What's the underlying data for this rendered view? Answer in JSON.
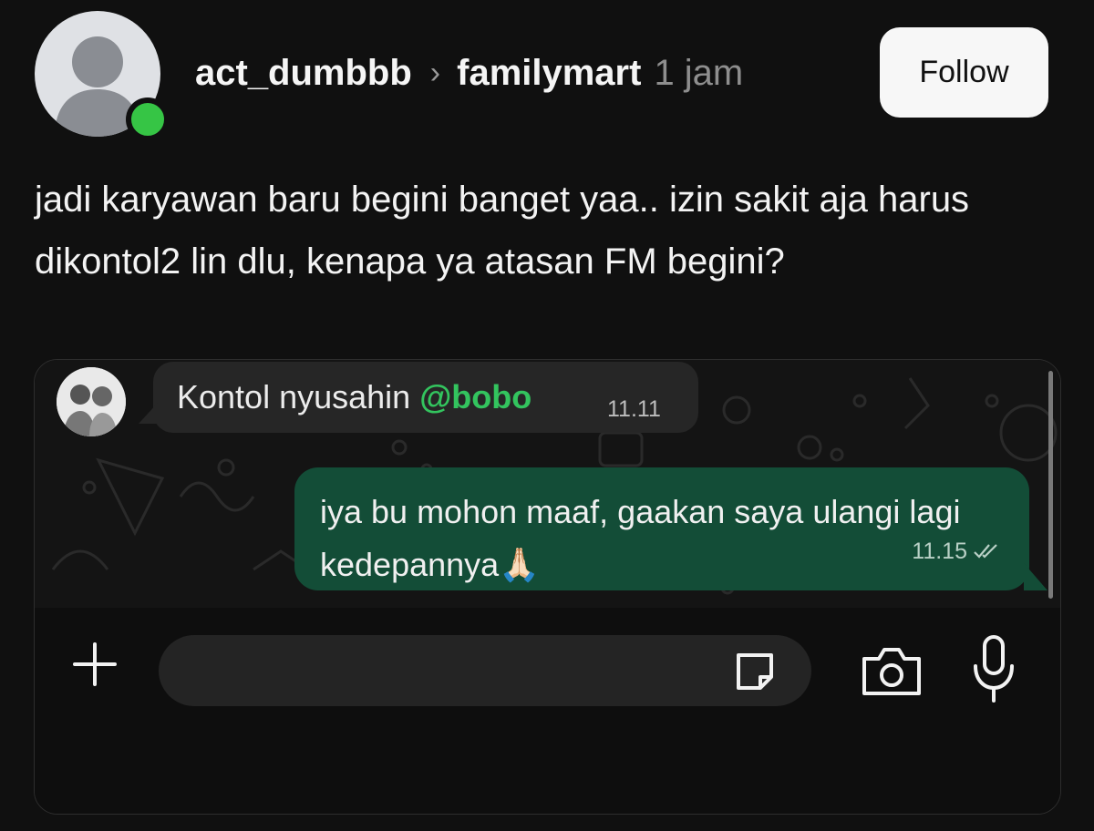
{
  "header": {
    "username": "act_dumbbb",
    "separator": "›",
    "group": "familymart",
    "time_ago": "1 jam",
    "follow_label": "Follow",
    "online_color": "#36c545"
  },
  "post": {
    "text": "jadi karyawan baru begini banget yaa.. izin sakit aja harus dikontol2 lin dlu, kenapa ya atasan FM begini?"
  },
  "chat": {
    "incoming": {
      "text": "Kontol nyusahin ",
      "mention": "@bobo",
      "time": "11.11"
    },
    "outgoing": {
      "text": "iya bu mohon maaf, gaakan saya ulangi lagi kedepannya",
      "emoji": "🙏🏻",
      "time": "11.15",
      "status_icon": "double-check-icon"
    },
    "composer": {
      "placeholder": "",
      "icons": [
        "plus-icon",
        "sticker-icon",
        "camera-icon",
        "microphone-icon"
      ]
    },
    "colors": {
      "outgoing_bubble": "#134d37",
      "incoming_bubble": "#262626",
      "mention": "#33c45e"
    }
  }
}
